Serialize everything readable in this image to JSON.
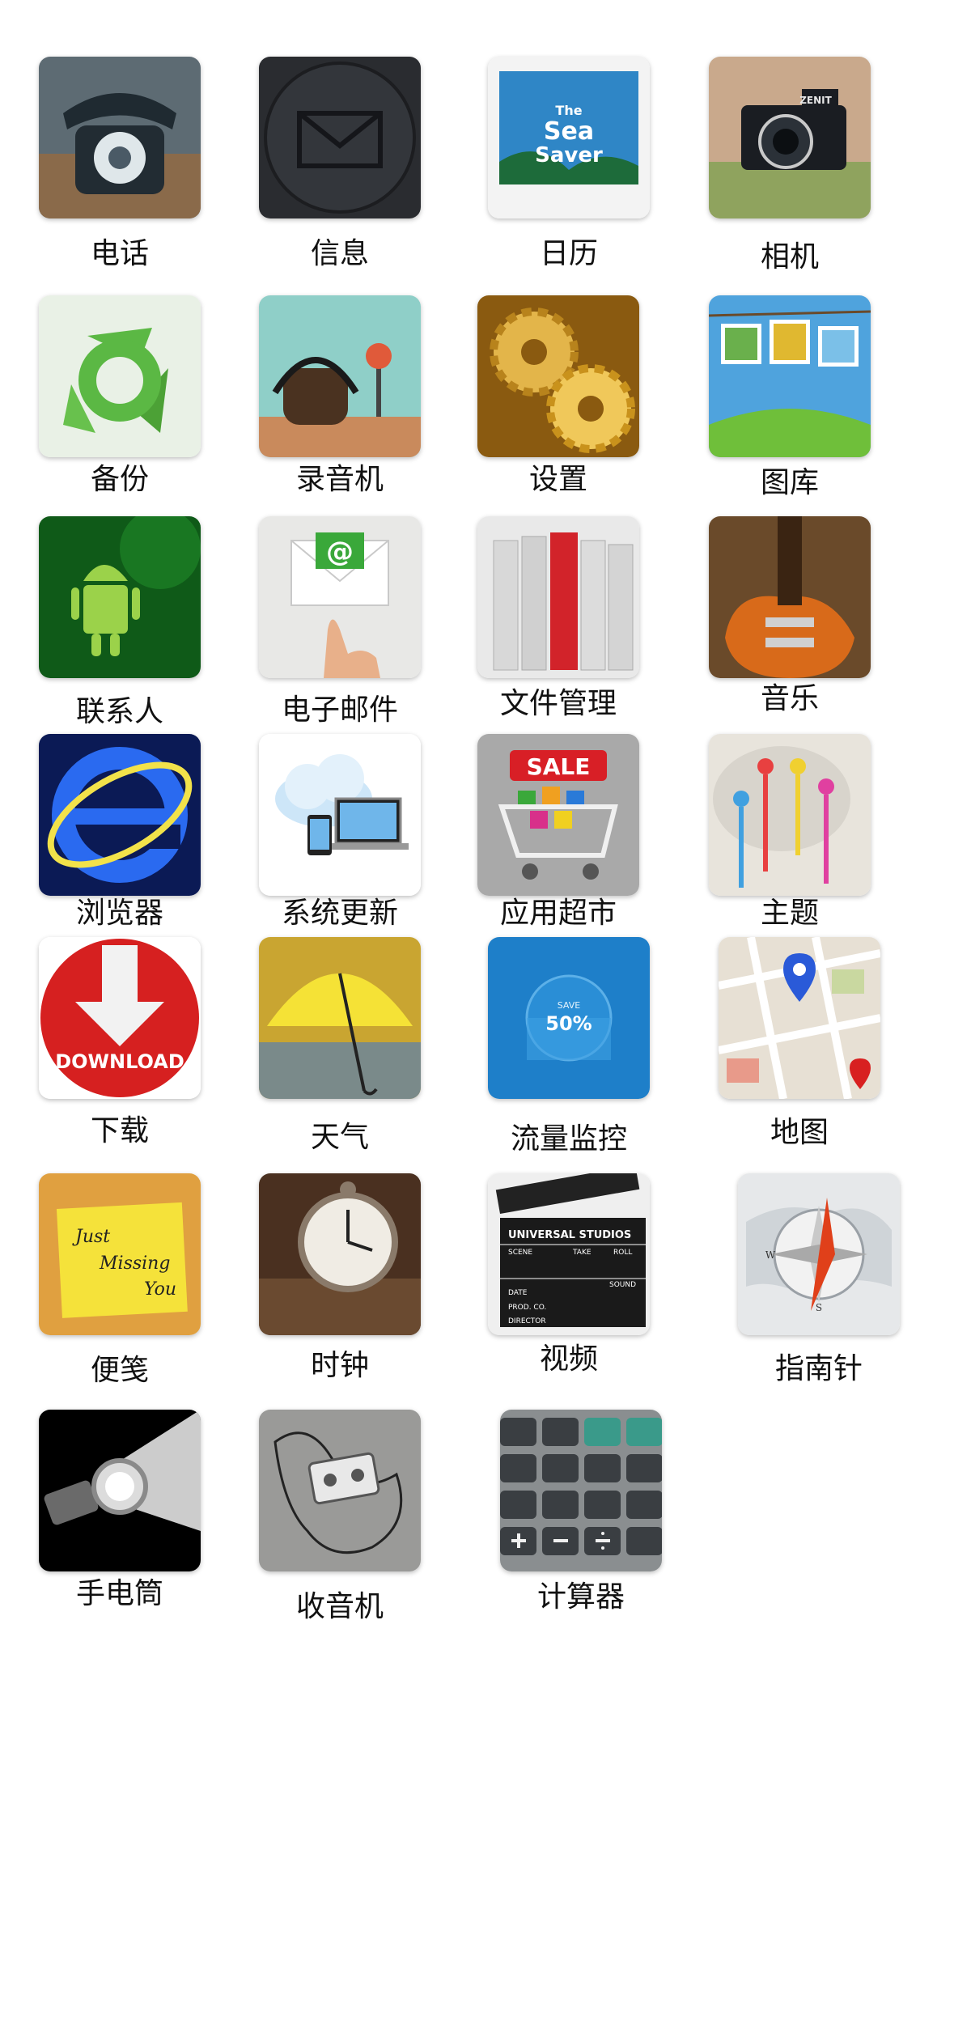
{
  "apps": [
    {
      "id": "phone",
      "label": "电话",
      "icon": "rotary-phone-icon",
      "bg": "#2f3a40"
    },
    {
      "id": "messages",
      "label": "信息",
      "icon": "envelope-icon",
      "bg": "#2a2c30"
    },
    {
      "id": "calendar",
      "label": "日历",
      "icon": "calendar-icon",
      "bg": "#2f86c6",
      "icon_text": [
        "The",
        "Sea",
        "Saver"
      ]
    },
    {
      "id": "camera",
      "label": "相机",
      "icon": "camera-icon",
      "bg": "#c9a98c",
      "icon_text": [
        "ZENIT"
      ]
    },
    {
      "id": "backup",
      "label": "备份",
      "icon": "recycle-arrows-icon",
      "bg": "#e9f1e6"
    },
    {
      "id": "recorder",
      "label": "录音机",
      "icon": "headphones-radio-icon",
      "bg": "#8fcfc8"
    },
    {
      "id": "settings",
      "label": "设置",
      "icon": "gears-icon",
      "bg": "#c9921c"
    },
    {
      "id": "gallery",
      "label": "图库",
      "icon": "photos-icon",
      "bg": "#4fa3dd"
    },
    {
      "id": "contacts",
      "label": "联系人",
      "icon": "android-icon",
      "bg": "#0f5a18"
    },
    {
      "id": "email",
      "label": "电子邮件",
      "icon": "email-touch-icon",
      "bg": "#e8e8e6",
      "icon_text": [
        "@"
      ]
    },
    {
      "id": "file-manager",
      "label": "文件管理",
      "icon": "binders-icon",
      "bg": "#e9e9e9"
    },
    {
      "id": "music",
      "label": "音乐",
      "icon": "guitar-icon",
      "bg": "#6a4a2a"
    },
    {
      "id": "browser",
      "label": "浏览器",
      "icon": "ie-browser-icon",
      "bg": "#0b1a55"
    },
    {
      "id": "system-update",
      "label": "系统更新",
      "icon": "cloud-devices-icon",
      "bg": "#ffffff"
    },
    {
      "id": "app-market",
      "label": "应用超市",
      "icon": "shopping-cart-icon",
      "bg": "#a9a9a9",
      "icon_text": [
        "SALE"
      ]
    },
    {
      "id": "theme",
      "label": "主题",
      "icon": "paint-palette-icon",
      "bg": "#e8e4dc"
    },
    {
      "id": "download",
      "label": "下载",
      "icon": "download-icon",
      "bg": "#d62020",
      "icon_text": [
        "DOWNLOAD"
      ]
    },
    {
      "id": "weather",
      "label": "天气",
      "icon": "umbrella-icon",
      "bg": "#c9a531"
    },
    {
      "id": "data-monitor",
      "label": "流量监控",
      "icon": "data-gauge-icon",
      "bg": "#1e7fc9",
      "icon_text": [
        "SAVE",
        "50%"
      ]
    },
    {
      "id": "map",
      "label": "地图",
      "icon": "map-pin-icon",
      "bg": "#e7e0d4"
    },
    {
      "id": "notes",
      "label": "便笺",
      "icon": "sticky-note-icon",
      "bg": "#e0a040",
      "icon_text": [
        "Just",
        "Missing",
        "You"
      ]
    },
    {
      "id": "clock",
      "label": "时钟",
      "icon": "pocket-watch-icon",
      "bg": "#4a3020"
    },
    {
      "id": "video",
      "label": "视频",
      "icon": "clapperboard-icon",
      "bg": "#efefef",
      "icon_text": [
        "UNIVERSAL STUDIOS",
        "SCENE",
        "TAKE",
        "ROLL",
        "SOUND",
        "DATE",
        "PROD. CO.",
        "DIRECTOR"
      ]
    },
    {
      "id": "compass",
      "label": "指南针",
      "icon": "compass-icon",
      "bg": "#e6e8ea",
      "icon_text": [
        "W",
        "S"
      ]
    },
    {
      "id": "flashlight",
      "label": "手电筒",
      "icon": "flashlight-icon",
      "bg": "#000000"
    },
    {
      "id": "radio",
      "label": "收音机",
      "icon": "cassette-tape-icon",
      "bg": "#9a9a98"
    },
    {
      "id": "calculator",
      "label": "计算器",
      "icon": "calculator-icon",
      "bg": "#8a8e90"
    }
  ]
}
